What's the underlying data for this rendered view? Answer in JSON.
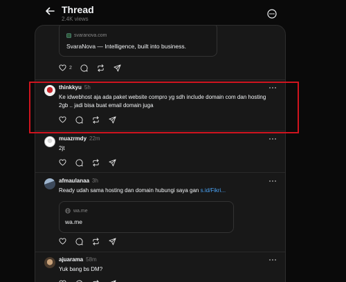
{
  "header": {
    "title": "Thread",
    "views": "2.4K views"
  },
  "link_preview_1": {
    "domain": "svaranova.com",
    "title": "SvaraNova — Intelligence, built into business."
  },
  "post_1_actions": {
    "like_count": "2"
  },
  "replies": [
    {
      "username": "thinkkyu",
      "time": "5h",
      "text": "Ke idwebhost aja ada paket website compro yg sdh include domain com dan hosting 2gb .. jadi bisa buat email domain juga"
    },
    {
      "username": "muazrmdy",
      "time": "22m",
      "text": "2jt"
    },
    {
      "username": "afmaulanaa",
      "time": "3h",
      "text": "Ready udah sama hosting dan domain hubungi saya gan ",
      "link": "s.id/Fikri..."
    },
    {
      "username": "ajuarama",
      "time": "58m",
      "text": "Yuk bang bs DM?"
    }
  ],
  "link_preview_2": {
    "domain": "wa.me",
    "title": "wa.me"
  },
  "colors": {
    "background": "#0a0a0a",
    "panel": "#181818",
    "highlight_box": "#d1141f",
    "link": "#4aa3f5"
  }
}
